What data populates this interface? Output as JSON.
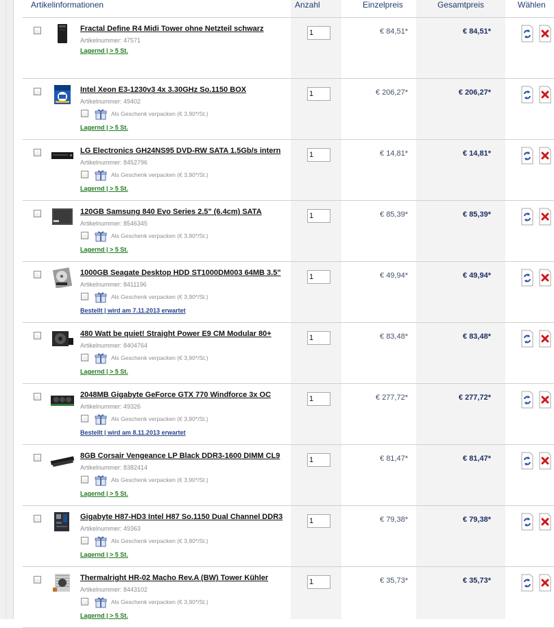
{
  "headers": {
    "info": "Artikelinformationen",
    "quantity": "Anzahl",
    "unit_price": "Einzelpreis",
    "total_price": "Gesamtpreis",
    "choose": "Wählen"
  },
  "gift_label": "Als Geschenk verpacken (€ 3,90*/St.)",
  "items": [
    {
      "name": "Fractal Define R4 Midi Tower ohne Netzteil schwarz",
      "artno": "Artikelnummer: 47571",
      "status": "Lagernd | > 5 St.",
      "status_type": "green",
      "qty": "1",
      "unit_price": "€ 84,51*",
      "total_price": "€ 84,51*",
      "gift": false,
      "thumb": "case-icon"
    },
    {
      "name": "Intel Xeon E3-1230v3 4x 3.30GHz So.1150 BOX",
      "artno": "Artikelnummer: 49402",
      "status": "Lagernd | > 5 St.",
      "status_type": "green",
      "qty": "1",
      "unit_price": "€ 206,27*",
      "total_price": "€ 206,27*",
      "gift": true,
      "thumb": "cpu-box-icon"
    },
    {
      "name": "LG Electronics GH24NS95 DVD-RW SATA 1.5Gb/s intern",
      "artno": "Artikelnummer: 8452796",
      "status": "Lagernd | > 5 St.",
      "status_type": "green",
      "qty": "1",
      "unit_price": "€ 14,81*",
      "total_price": "€ 14,81*",
      "gift": true,
      "thumb": "dvd-drive-icon"
    },
    {
      "name": "120GB Samsung 840 Evo Series 2.5\" (6.4cm) SATA",
      "artno": "Artikelnummer: 8546345",
      "status": "Lagernd | > 5 St.",
      "status_type": "green",
      "qty": "1",
      "unit_price": "€ 85,39*",
      "total_price": "€ 85,39*",
      "gift": true,
      "thumb": "ssd-icon"
    },
    {
      "name": "1000GB Seagate Desktop HDD ST1000DM003 64MB 3.5\"",
      "artno": "Artikelnummer: 8411196",
      "status": "Bestellt | wird am 7.11.2013 erwartet",
      "status_type": "blue",
      "qty": "1",
      "unit_price": "€ 49,94*",
      "total_price": "€ 49,94*",
      "gift": true,
      "thumb": "hdd-icon"
    },
    {
      "name": "480 Watt be quiet! Straight Power E9 CM Modular 80+",
      "artno": "Artikelnummer: 8404764",
      "status": "Lagernd | > 5 St.",
      "status_type": "green",
      "qty": "1",
      "unit_price": "€ 83,48*",
      "total_price": "€ 83,48*",
      "gift": true,
      "thumb": "psu-icon"
    },
    {
      "name": "2048MB Gigabyte GeForce GTX 770 Windforce 3x OC",
      "artno": "Artikelnummer: 49326",
      "status": "Bestellt | wird am 8.11.2013 erwartet",
      "status_type": "blue",
      "qty": "1",
      "unit_price": "€ 277,72*",
      "total_price": "€ 277,72*",
      "gift": true,
      "thumb": "gpu-icon"
    },
    {
      "name": "8GB Corsair Vengeance LP Black DDR3-1600 DIMM CL9",
      "artno": "Artikelnummer: 8382414",
      "status": "Lagernd | > 5 St.",
      "status_type": "green",
      "qty": "1",
      "unit_price": "€ 81,47*",
      "total_price": "€ 81,47*",
      "gift": true,
      "thumb": "ram-icon"
    },
    {
      "name": "Gigabyte H87-HD3 Intel H87 So.1150 Dual Channel DDR3",
      "artno": "Artikelnummer: 49363",
      "status": "Lagernd | > 5 St.",
      "status_type": "green",
      "qty": "1",
      "unit_price": "€ 79,38*",
      "total_price": "€ 79,38*",
      "gift": true,
      "thumb": "motherboard-icon"
    },
    {
      "name": "Thermalright HR-02 Macho Rev.A (BW) Tower Kühler",
      "artno": "Artikelnummer: 8443102",
      "status": "Lagernd | > 5 St.",
      "status_type": "green",
      "qty": "1",
      "unit_price": "€ 35,73*",
      "total_price": "€ 35,73*",
      "gift": true,
      "thumb": "cooler-icon"
    }
  ]
}
